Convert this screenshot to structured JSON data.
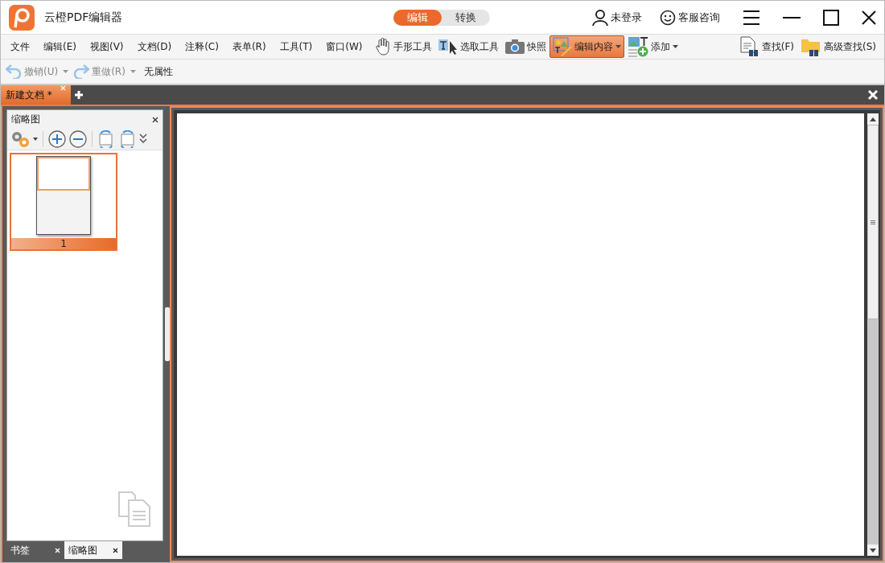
{
  "app": {
    "title": "云橙PDF编辑器"
  },
  "mode_tabs": [
    {
      "label": "编辑",
      "selected": true
    },
    {
      "label": "转换",
      "selected": false
    }
  ],
  "header_links": [
    {
      "kind": "user",
      "label": "未登录"
    },
    {
      "kind": "support",
      "label": "客服咨询"
    }
  ],
  "menu": [
    "文件",
    "编辑(E)",
    "视图(V)",
    "文档(D)",
    "注释(C)",
    "表单(R)",
    "工具(T)",
    "窗口(W)"
  ],
  "tools": [
    {
      "kind": "hand",
      "label": "手形工具",
      "selected": false,
      "dropdown": false
    },
    {
      "kind": "select",
      "label": "选取工具",
      "selected": false,
      "dropdown": false
    },
    {
      "kind": "snapshot",
      "label": "快照",
      "selected": false,
      "dropdown": false
    },
    {
      "kind": "edit",
      "label": "编辑内容",
      "selected": true,
      "dropdown": true
    },
    {
      "kind": "add",
      "label": "添加",
      "selected": false,
      "dropdown": true
    }
  ],
  "search_tools": [
    {
      "kind": "find",
      "label": "查找(F)"
    },
    {
      "kind": "advanced",
      "label": "高级查找(S)"
    }
  ],
  "history": [
    {
      "kind": "undo",
      "label": "撤销(U)",
      "disabled": true
    },
    {
      "kind": "redo",
      "label": "重做(R)",
      "disabled": true
    }
  ],
  "property_label": "无属性",
  "doc_tabs": [
    {
      "label": "新建文档 *",
      "selected": true
    }
  ],
  "panel": {
    "title": "缩略图",
    "pages": [
      {
        "label": "1",
        "selected": true
      }
    ],
    "bottom_tabs": [
      {
        "label": "书签",
        "selected": false
      },
      {
        "label": "缩略图",
        "selected": true
      }
    ]
  }
}
